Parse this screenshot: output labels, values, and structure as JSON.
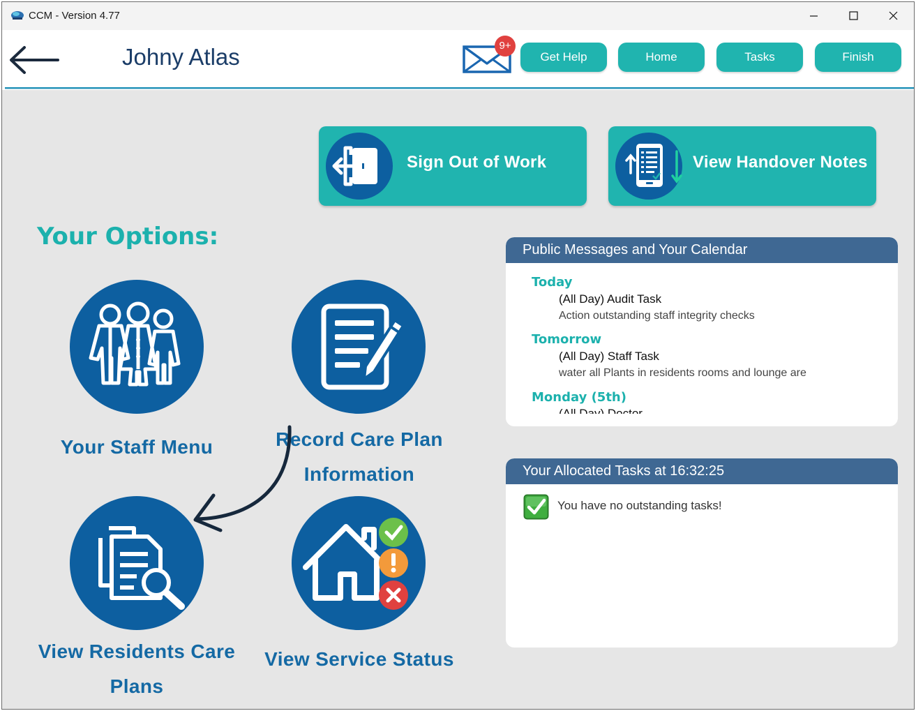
{
  "window": {
    "title": "CCM - Version 4.77",
    "controls": [
      "minimize",
      "maximize",
      "close"
    ]
  },
  "header": {
    "user_name": "Johny Atlas",
    "mail_badge": "9+",
    "buttons": [
      {
        "label": "Get Help"
      },
      {
        "label": "Home"
      },
      {
        "label": "Tasks"
      },
      {
        "label": "Finish"
      }
    ]
  },
  "tiles": {
    "sign_out": {
      "label": "Sign Out of Work",
      "icon": "door-exit-icon"
    },
    "handover": {
      "label": "View Handover Notes",
      "icon": "clipboard-list-icon"
    }
  },
  "options": {
    "title": "Your Options:",
    "staff_menu": {
      "label": "Your Staff Menu",
      "icon": "staff-group-icon"
    },
    "record_care": {
      "line1": "Record Care Plan",
      "line2": "Information",
      "icon": "document-edit-icon"
    },
    "view_residents": {
      "line1": "View Residents Care",
      "line2": "Plans",
      "icon": "document-search-icon"
    },
    "service_status": {
      "label": "View Service Status",
      "icon": "house-status-icon"
    }
  },
  "calendar_panel": {
    "title": "Public Messages and Your Calendar",
    "entries": [
      {
        "day": "Today",
        "title": "(All Day) Audit Task",
        "desc": "Action outstanding staff integrity checks"
      },
      {
        "day": "Tomorrow",
        "title": "(All Day) Staff Task",
        "desc": "water all Plants in residents rooms and lounge are"
      },
      {
        "day": "Monday (5th)",
        "title": "(All Day) Doctor",
        "desc": ""
      }
    ]
  },
  "tasks_panel": {
    "title": "Your Allocated Tasks at 16:32:25",
    "message": "You have no outstanding tasks!"
  },
  "colors": {
    "teal": "#20b4af",
    "navy": "#0d5fa0",
    "panel_header": "#3f6893",
    "badge": "#e0413f"
  }
}
